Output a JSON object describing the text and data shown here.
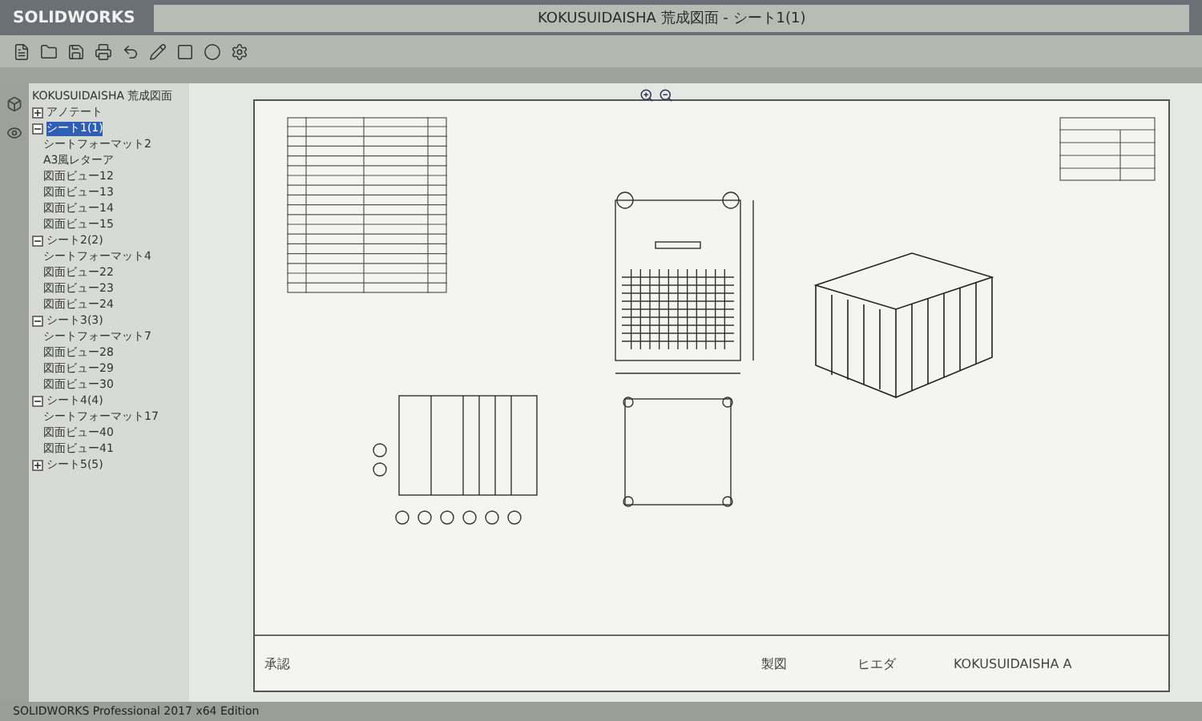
{
  "app": {
    "logo": "SOLIDWORKS",
    "document_title": "KOKUSUIDAISHA 荒成図面 - シート1(1)"
  },
  "tree": {
    "root": "KOKUSUIDAISHA 荒成図面",
    "items": [
      {
        "label": "アノテート",
        "selected": false,
        "expanded": false
      },
      {
        "label": "シート1(1)",
        "selected": true,
        "expanded": true,
        "children": [
          {
            "label": "シートフォーマット2"
          },
          {
            "label": "A3風レターア"
          },
          {
            "label": "図面ビュー12"
          },
          {
            "label": "図面ビュー13"
          },
          {
            "label": "図面ビュー14"
          },
          {
            "label": "図面ビュー15"
          }
        ]
      },
      {
        "label": "シート2(2)",
        "selected": false,
        "expanded": true,
        "children": [
          {
            "label": "シートフォーマット4"
          },
          {
            "label": "図面ビュー22"
          },
          {
            "label": "図面ビュー23"
          },
          {
            "label": "図面ビュー24"
          }
        ]
      },
      {
        "label": "シート3(3)",
        "selected": false,
        "expanded": true,
        "children": [
          {
            "label": "シートフォーマット7"
          },
          {
            "label": "図面ビュー28"
          },
          {
            "label": "図面ビュー29"
          },
          {
            "label": "図面ビュー30"
          }
        ]
      },
      {
        "label": "シート4(4)",
        "selected": false,
        "expanded": true,
        "children": [
          {
            "label": "シートフォーマット17"
          },
          {
            "label": "図面ビュー40"
          },
          {
            "label": "図面ビュー41"
          }
        ]
      },
      {
        "label": "シート5(5)",
        "selected": false,
        "expanded": false
      }
    ]
  },
  "sheet": {
    "title_block": {
      "approved_label": "承認",
      "drawn_label": "製図",
      "designer": "ヒエダ",
      "drawing_name": "KOKUSUIDAISHA A"
    }
  },
  "status_bar": {
    "text": "SOLIDWORKS Professional 2017 x64 Edition"
  }
}
